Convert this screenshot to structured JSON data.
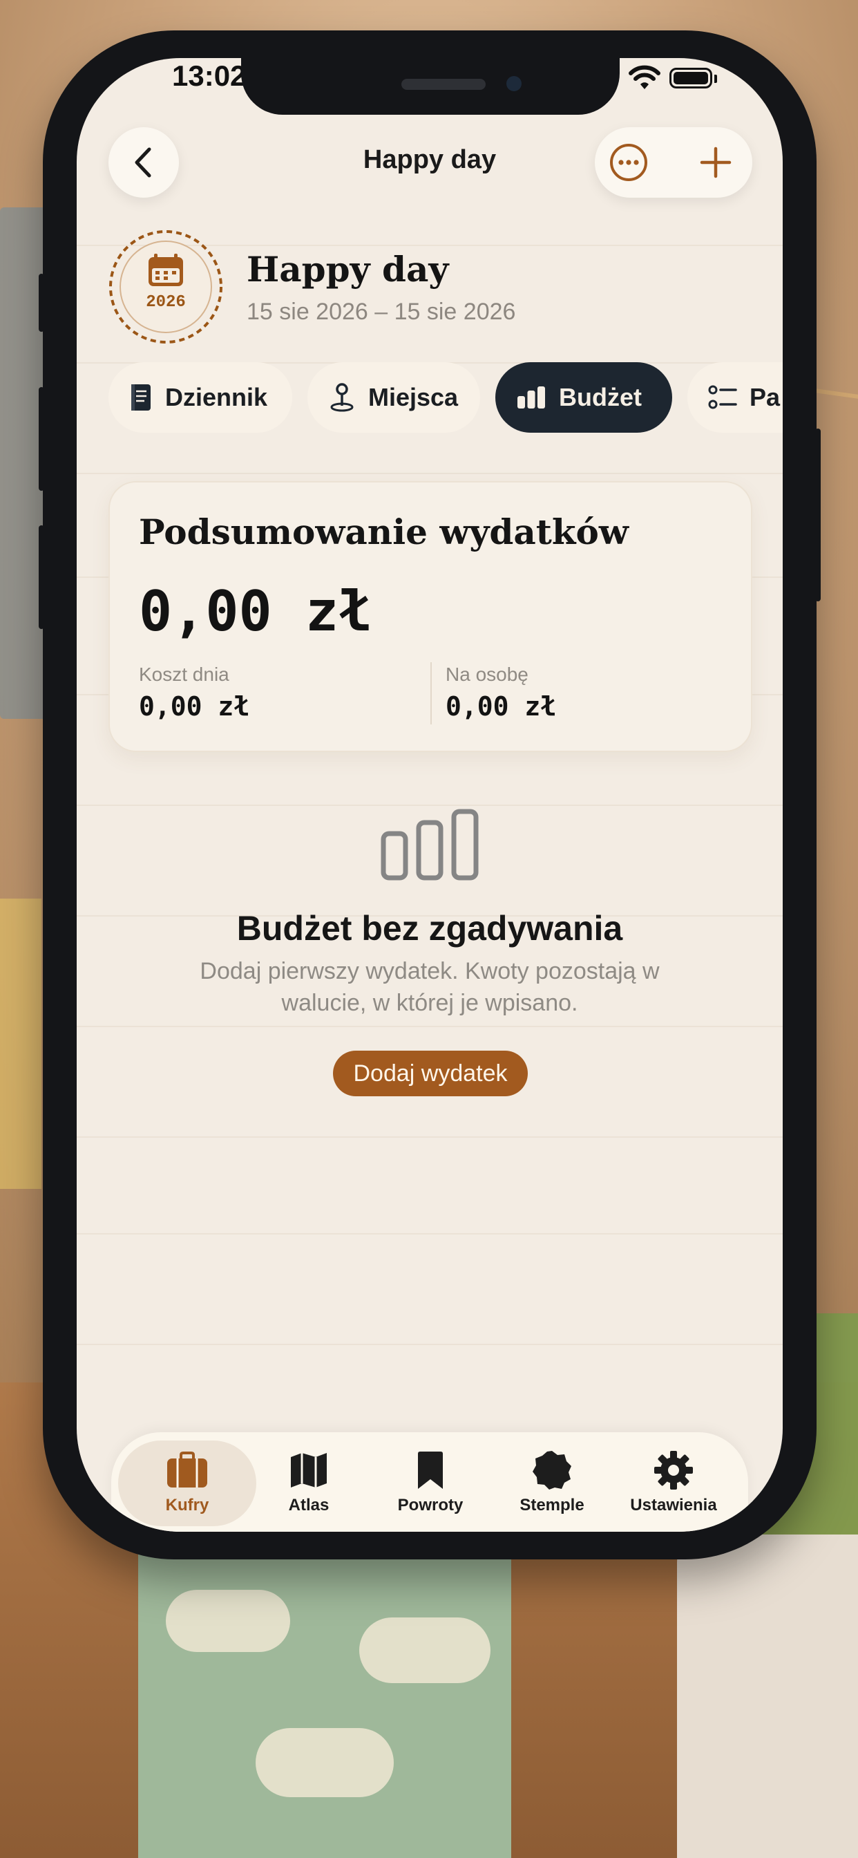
{
  "status_bar": {
    "time": "13:02"
  },
  "nav": {
    "title": "Happy day"
  },
  "trip": {
    "title": "Happy day",
    "dates": "15 sie 2026 – 15 sie 2026",
    "stamp_year": "2026"
  },
  "tabs": [
    {
      "label": "Dziennik",
      "icon": "journal-icon",
      "active": false
    },
    {
      "label": "Miejsca",
      "icon": "pin-icon",
      "active": false
    },
    {
      "label": "Budżet",
      "icon": "chart-icon",
      "active": true
    },
    {
      "label": "Pa",
      "icon": "checklist-icon",
      "active": false
    }
  ],
  "summary": {
    "title": "Podsumowanie wydatków",
    "total": "0,00 zł",
    "daily_label": "Koszt dnia",
    "daily_value": "0,00 zł",
    "person_label": "Na osobę",
    "person_value": "0,00 zł"
  },
  "empty": {
    "title": "Budżet bez zgadywania",
    "body": "Dodaj pierwszy wydatek. Kwoty pozostają w walucie, w której je wpisano.",
    "cta": "Dodaj wydatek"
  },
  "tabbar": [
    {
      "label": "Kufry",
      "icon": "suitcase-icon",
      "active": true
    },
    {
      "label": "Atlas",
      "icon": "map-icon",
      "active": false
    },
    {
      "label": "Powroty",
      "icon": "bookmark-icon",
      "active": false
    },
    {
      "label": "Stemple",
      "icon": "stamp-badge-icon",
      "active": false
    },
    {
      "label": "Ustawienia",
      "icon": "gear-icon",
      "active": false
    }
  ],
  "colors": {
    "accent": "#a25a1f",
    "active_tab": "#1d2630",
    "screen_bg": "#f3ece3",
    "card_bg": "#f6f0e7"
  }
}
